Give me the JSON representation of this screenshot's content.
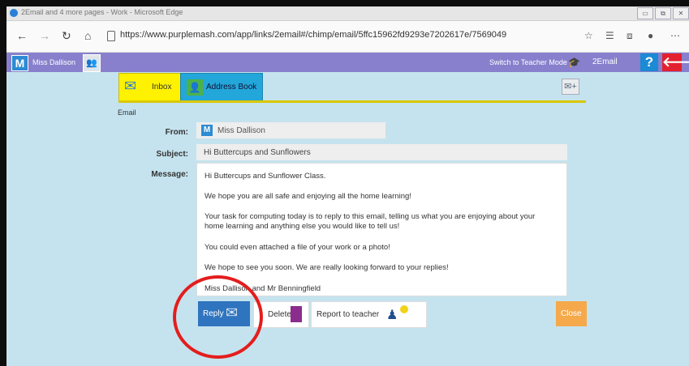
{
  "window": {
    "title": "2Email and 4 more pages - Work - Microsoft Edge"
  },
  "browser": {
    "url": "https://www.purplemash.com/app/links/2email#/chimp/email/5ffc15962fd9293e7202617e/7569049"
  },
  "appbar": {
    "logo": "M",
    "user": "Miss Dallison",
    "teacher_mode": "Switch to Teacher Mode",
    "app_name": "2Email",
    "help": "?",
    "back": "🡐"
  },
  "tabs": {
    "inbox": "Inbox",
    "address_book": "Address Book"
  },
  "email": {
    "section_label": "Email",
    "from_label": "From:",
    "from_value": "Miss Dallison",
    "subject_label": "Subject:",
    "subject_value": "Hi Buttercups and Sunflowers",
    "message_label": "Message:",
    "message_paragraphs": [
      "Hi Buttercups and Sunflower Class.",
      "We hope you are all safe and enjoying all the home learning!",
      "Your task for computing today is to reply to this email, telling us what you are enjoying about your home learning and anything else you would like to tell us!",
      "You could even attached a file of your work or a photo!",
      "We hope to see you soon. We are really looking forward to your replies!",
      "Miss Dallison and Mr Benningfield"
    ]
  },
  "actions": {
    "reply": "Reply",
    "delete": "Delete",
    "report": "Report to teacher",
    "close": "Close"
  },
  "colors": {
    "background": "#c5e3ee",
    "appbar": "#8880cc",
    "inbox_tab": "#fff200",
    "address_tab": "#23a6d9",
    "reply": "#2f74bf",
    "close": "#f5a94a",
    "annotation": "#e41d1d"
  }
}
